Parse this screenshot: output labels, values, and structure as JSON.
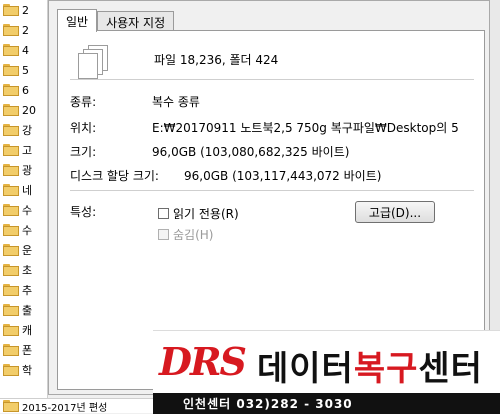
{
  "explorer": {
    "items": [
      {
        "label": "2"
      },
      {
        "label": "2"
      },
      {
        "label": "4"
      },
      {
        "label": "5"
      },
      {
        "label": "6"
      },
      {
        "label": "20"
      },
      {
        "label": "강"
      },
      {
        "label": "고"
      },
      {
        "label": "광"
      },
      {
        "label": "네"
      },
      {
        "label": "수"
      },
      {
        "label": "수"
      },
      {
        "label": "운"
      },
      {
        "label": "초"
      },
      {
        "label": "추"
      },
      {
        "label": "출"
      },
      {
        "label": "캐"
      },
      {
        "label": "폰"
      },
      {
        "label": "학"
      }
    ],
    "bottom_file": "2015-2017년 편성"
  },
  "dialog": {
    "tabs": [
      "일반",
      "사용자 지정"
    ],
    "summary": "파일 18,236, 폴더 424",
    "type_label": "종류:",
    "type_value": "복수 종류",
    "location_label": "위치:",
    "location_value": "E:₩20170911 노트북2,5 750g 복구파일₩Desktop의 5",
    "size_label": "크기:",
    "size_value": "96,0GB (103,080,682,325 바이트)",
    "disk_label": "디스크 할당 크기:",
    "disk_value": "96,0GB (103,117,443,072 바이트)",
    "attributes_label": "특성:",
    "readonly_label": "읽기 전용(R)",
    "hidden_label": "숨김(H)",
    "advanced_label": "고급(D)..."
  },
  "banner": {
    "logo": "DRS",
    "brand_part1": "데이터",
    "brand_part2": "복구",
    "brand_part3": "센터",
    "phone": "인천센터  032)282 - 3030",
    "colors": {
      "accent": "#d71920",
      "dark": "#111111"
    }
  }
}
